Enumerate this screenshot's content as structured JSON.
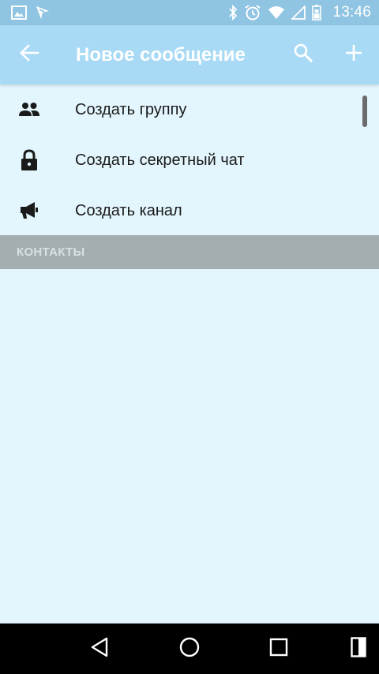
{
  "status_bar": {
    "time": "13:46",
    "left_icons": [
      "image-icon",
      "app-notification-icon"
    ],
    "right_icons": [
      "bluetooth-icon",
      "alarm-icon",
      "wifi-icon",
      "signal-icon",
      "battery-icon"
    ]
  },
  "app_bar": {
    "title": "Новое сообщение",
    "icons": [
      "back-arrow-icon",
      "search-icon",
      "plus-icon"
    ],
    "background": "#a8daf5"
  },
  "menu": {
    "items": [
      {
        "label": "Создать группу",
        "icon": "group-icon"
      },
      {
        "label": "Создать секретный чат",
        "icon": "lock-icon"
      },
      {
        "label": "Создать канал",
        "icon": "megaphone-icon"
      }
    ]
  },
  "contacts_section": {
    "header": "КОНТАКТЫ"
  },
  "nav_bar": {
    "icons": [
      "nav-back-icon",
      "nav-home-icon",
      "nav-recents-icon",
      "nav-extra-icon"
    ]
  },
  "colors": {
    "page_background": "#e3f6fd",
    "status_bar": "#8fc4e2",
    "section_header": "#a3aeb0"
  }
}
